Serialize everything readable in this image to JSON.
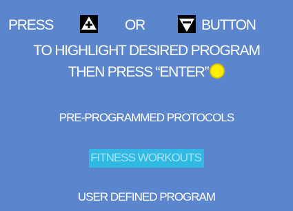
{
  "instructions": {
    "press": "PRESS",
    "or": "OR",
    "button": "BUTTON",
    "line2": "TO HIGHLIGHT DESIRED PROGRAM",
    "line3": "THEN PRESS “ENTER”",
    "up_icon": "plus-up-arrow-icon",
    "down_icon": "minus-down-arrow-icon",
    "enter_icon": "yellow-circle-icon",
    "enter_color": "#ffee00"
  },
  "menu": {
    "items": [
      {
        "label": "PRE-PROGRAMMED PROTOCOLS",
        "selected": false
      },
      {
        "label": "FITNESS WORKOUTS",
        "selected": true
      },
      {
        "label": "USER DEFINED PROGRAM",
        "selected": false
      }
    ],
    "highlight_color": "#2fb9e3"
  },
  "colors": {
    "background": "#5b86cd",
    "text": "#ffffff"
  }
}
